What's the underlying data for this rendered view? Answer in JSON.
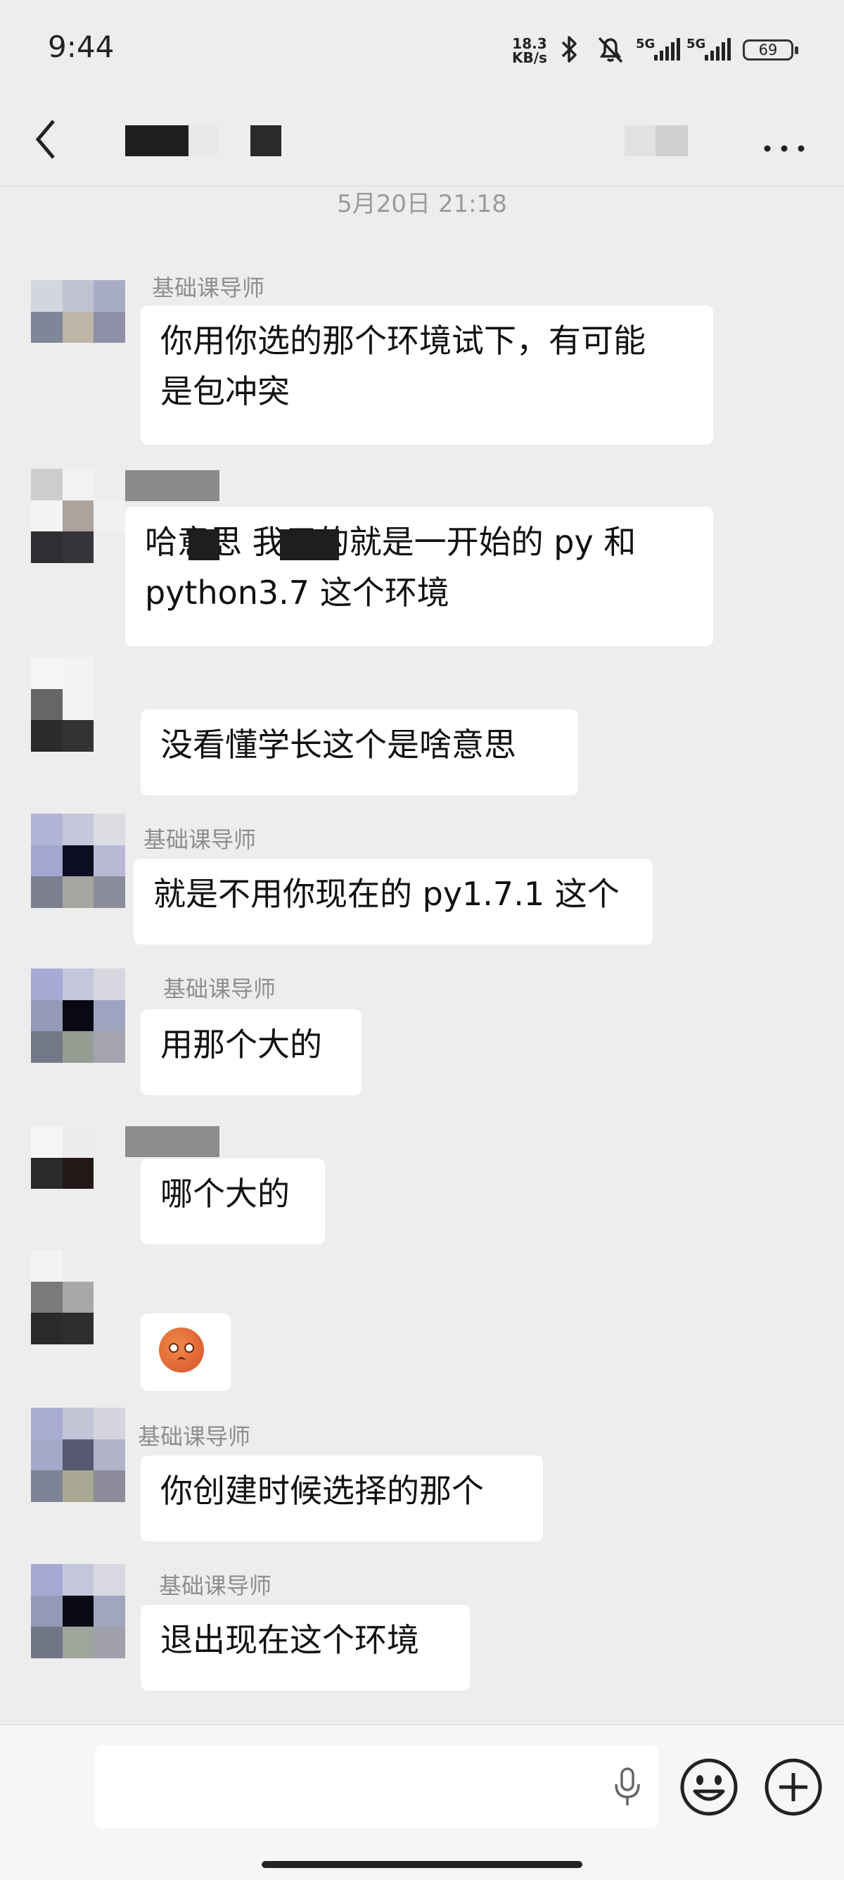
{
  "status_bar": {
    "time": "9:44",
    "speed_value": "18.3",
    "speed_unit": "KB/s",
    "network_1": "5G",
    "network_2": "5G",
    "battery": "69"
  },
  "timestamp": "5月20日 21:18",
  "messages": [
    {
      "name": "基础课导师",
      "text": "你用你选的那个环境试下，有可能\n是包冲突"
    },
    {
      "name": "",
      "text": "哈意思 我用的就是一开始的 py 和\npython3.7 这个环境"
    },
    {
      "name": "",
      "text": "没看懂学长这个是啥意思"
    },
    {
      "name": "基础课导师",
      "text": "就是不用你现在的 py1.7.1 这个"
    },
    {
      "name": "基础课导师",
      "text": "用那个大的"
    },
    {
      "name": "",
      "text": "哪个大的"
    },
    {
      "name": "",
      "text": ""
    },
    {
      "name": "基础课导师",
      "text": "你创建时候选择的那个"
    },
    {
      "name": "基础课导师",
      "text": "退出现在这个环境"
    }
  ],
  "icons": {
    "back": "back-arrow-icon",
    "more": "more-icon",
    "mic": "microphone-icon",
    "emoji": "emoji-icon",
    "add": "plus-icon",
    "sticker": "flushed-face-emoji"
  }
}
